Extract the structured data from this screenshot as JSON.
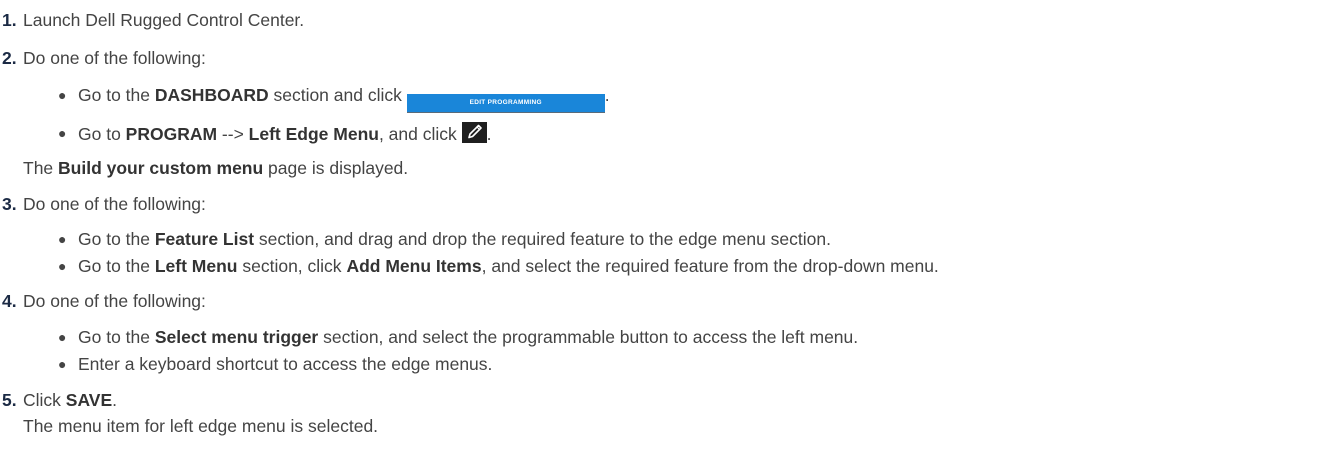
{
  "steps": [
    {
      "num": "1.",
      "text": "Launch Dell Rugged Control Center."
    },
    {
      "num": "2.",
      "text": "Do one of the following:",
      "bullets": [
        {
          "pre": "Go to the ",
          "bold": "DASHBOARD",
          "post": " section and click ",
          "button_label": "EDIT PROGRAMMING",
          "end": "."
        },
        {
          "pre": "Go to ",
          "bold1": "PROGRAM",
          "mid1": " --> ",
          "bold2": "Left Edge Menu",
          "mid2": ", and click ",
          "icon": "pencil-icon",
          "end": "."
        }
      ],
      "result": {
        "pre": "The ",
        "bold": "Build your custom menu",
        "post": " page is displayed."
      }
    },
    {
      "num": "3.",
      "text": "Do one of the following:",
      "bullets": [
        {
          "pre": "Go to the ",
          "bold": "Feature List",
          "post": " section, and drag and drop the required feature to the edge menu section."
        },
        {
          "pre": "Go to the ",
          "bold1": "Left Menu",
          "mid1": " section, click ",
          "bold2": "Add Menu Items",
          "post": ", and select the required feature from the drop-down menu."
        }
      ]
    },
    {
      "num": "4.",
      "text": "Do one of the following:",
      "bullets": [
        {
          "pre": "Go to the ",
          "bold": "Select menu trigger",
          "post": " section, and select the programmable button to access the left menu."
        },
        {
          "text": "Enter a keyboard shortcut to access the edge menus."
        }
      ]
    },
    {
      "num": "5.",
      "pre": "Click ",
      "bold": "SAVE",
      "post": ".",
      "result": "The menu item for left edge menu is selected."
    }
  ],
  "bullet_glyph": "●",
  "colors": {
    "text": "#444444",
    "number": "#1b2a44",
    "button": "#1a86d9",
    "icon_bg": "#1f1f1f"
  }
}
